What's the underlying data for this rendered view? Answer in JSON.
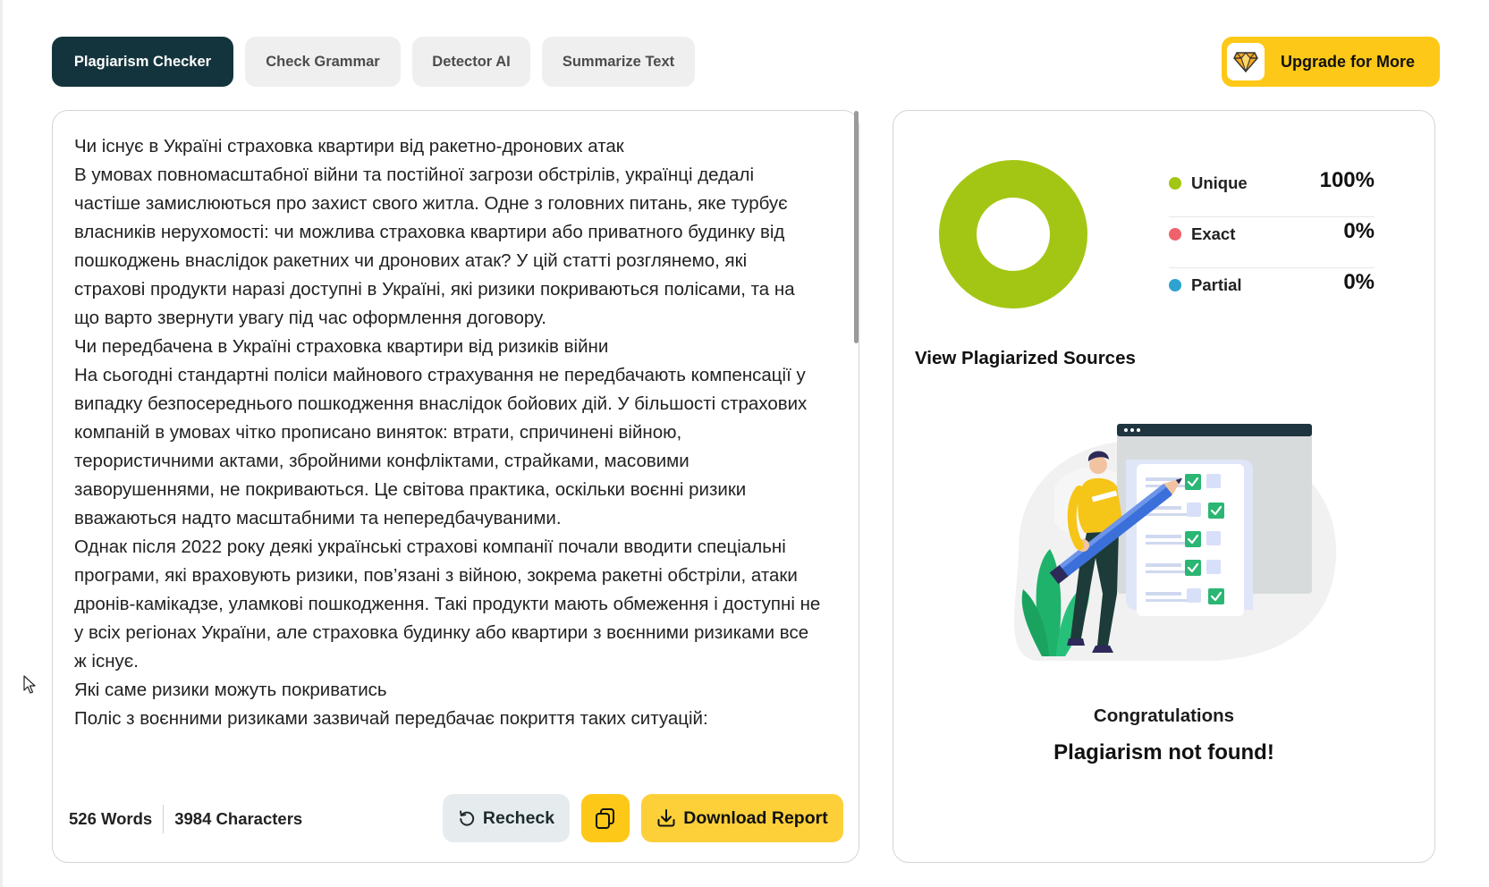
{
  "tabs": [
    {
      "label": "Plagiarism Checker",
      "active": true
    },
    {
      "label": "Check Grammar",
      "active": false
    },
    {
      "label": "Detector AI",
      "active": false
    },
    {
      "label": "Summarize Text",
      "active": false
    }
  ],
  "upgrade": {
    "label": "Upgrade for More",
    "icon": "gem-icon"
  },
  "editor": {
    "text": "Чи існує в Україні страховка квартири від ракетно-дронових атак\nВ умовах повномасштабної війни та постійної загрози обстрілів, українці дедалі частіше замислюються про захист свого житла. Одне з головних питань, яке турбує власників нерухомості: чи можлива страховка квартири або приватного будинку від пошкоджень внаслідок ракетних чи дронових атак? У цій статті розглянемо, які страхові продукти наразі доступні в Україні, які ризики покриваються полісами, та на що варто звернути увагу під час оформлення договору.\nЧи передбачена в Україні страховка квартири від ризиків війни\nНа сьогодні стандартні поліси майнового страхування не передбачають компенсації у випадку безпосереднього пошкодження внаслідок бойових дій. У більшості страхових компаній в умовах чітко прописано виняток: втрати, спричинені війною, терористичними актами, збройними конфліктами, страйками, масовими заворушеннями, не покриваються. Це світова практика, оскільки воєнні ризики вважаються надто масштабними та непередбачуваними.\nОднак після 2022 року деякі українські страхові компанії почали вводити спеціальні програми, які враховують ризики, пов’язані з війною, зокрема ракетні обстріли, атаки дронів-камікадзе, уламкові пошкодження. Такі продукти мають обмеження і доступні не у всіх регіонах України, але страховка будинку або квартири з воєнними ризиками все ж існує.\nЯкі саме ризики можуть покриватись\nПоліс з воєнними ризиками зазвичай передбачає покриття таких ситуацій:",
    "words": "526 Words",
    "characters": "3984 Characters",
    "recheck_label": "Recheck",
    "download_label": "Download Report"
  },
  "results": {
    "chart_data": {
      "type": "pie",
      "categories": [
        "Unique",
        "Exact",
        "Partial"
      ],
      "values": [
        100,
        0,
        0
      ],
      "colors": [
        "#a3c614",
        "#f0626b",
        "#2ea3d1"
      ]
    },
    "legend": [
      {
        "name": "Unique",
        "value": "100%",
        "color": "#a3c614"
      },
      {
        "name": "Exact",
        "value": "0%",
        "color": "#f0626b"
      },
      {
        "name": "Partial",
        "value": "0%",
        "color": "#2ea3d1"
      }
    ],
    "sources_link": "View Plagiarized Sources",
    "congrats": "Congratulations",
    "status": "Plagiarism not found!"
  },
  "colors": {
    "active_tab": "#14343d",
    "accent_yellow": "#fdc817"
  }
}
